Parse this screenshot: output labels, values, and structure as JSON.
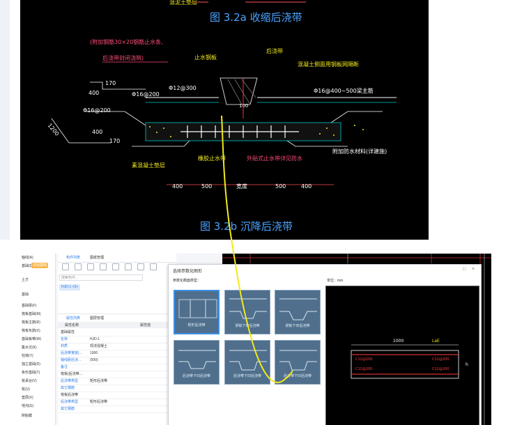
{
  "cad_drawing": {
    "top_caption": "图 3.2a 收缩后浇带",
    "top_fragment_left": "混泥土垫层",
    "bottom_caption": "图 3.2b 沉降后浇带",
    "labels": {
      "steel_bar_note_1": "(附加钢筋30×20钢筋止水条,",
      "steel_bar_note_2": "后浇带封闭浇筑)",
      "water_stop": "止水钢板",
      "post_pour_band": "后浇带",
      "formwork_note": "混凝土侧面用钢板网隔断",
      "dim_170_top": "170",
      "dim_400_top": "400",
      "bar_16_200_a": "Φ16@200",
      "bar_12_300": "Φ12@300",
      "bar_16_400_500": "Φ16@400~500梁主筋",
      "bar_16_200_b": "Φ16@200",
      "dim_1200": "1200",
      "dim_400_left": "400",
      "dim_170_left": "170",
      "dim_100": "100",
      "plain_concrete": "素混凝土垫层",
      "waterproof_layer": "橡胶止水带",
      "external_waterproof": "外贴式止水带详见防水",
      "additional_waterproof": "附加防水材料(详建施)",
      "dim_row": [
        "400",
        "500",
        "宽度",
        "500",
        "400"
      ]
    }
  },
  "app": {
    "left_nav": {
      "items": [
        "轴线(A)",
        "基础(D)",
        "土方",
        "基础",
        "基础梁(F)",
        "筏板基础(M)",
        "筏板主筋(R)",
        "筏板负筋(X)",
        "基础板带(W)",
        "集水坑(K)",
        "柱墩(Y)",
        "独立基础(D)",
        "条形基础(T)",
        "桩承台(V)",
        "桩(U)",
        "垫层(X)",
        "地沟(G)",
        "砖胎膜"
      ],
      "highlight_badge": "识别基础"
    },
    "mid_panel": {
      "tabs": [
        "构件列表",
        "图纸管理"
      ],
      "search_placeholder": "搜索构件...",
      "selected_chip": "HJD-1 <0>",
      "prop_tabs": [
        "属性列表",
        "图层管理"
      ],
      "prop_header": [
        "属性名称",
        "属性值"
      ],
      "rows": [
        {
          "k": "基础属性",
          "v": "",
          "group": true
        },
        {
          "k": "名称",
          "v": "HJD-1",
          "group": false
        },
        {
          "k": "材质",
          "v": "现浇混凝土",
          "group": false
        },
        {
          "k": "后浇带宽度(...",
          "v": "1000",
          "group": false
        },
        {
          "k": "轴线距后浇...",
          "v": "(500)",
          "group": false
        },
        {
          "k": "备注",
          "v": "",
          "group": false
        },
        {
          "k": "筏板(后浇带...",
          "v": "",
          "group": true
        },
        {
          "k": "后浇带类型",
          "v": "矩形后浇带",
          "group": false
        },
        {
          "k": "其它钢筋",
          "v": "",
          "group": false
        },
        {
          "k": "筏板后浇带",
          "v": "",
          "group": true
        },
        {
          "k": "后浇带类型",
          "v": "矩形后浇带",
          "group": false
        },
        {
          "k": "其它钢筋",
          "v": "",
          "group": false
        }
      ]
    },
    "dialog": {
      "title": "选择参数化图形",
      "subtitle": "参数化截面类型：",
      "unit": "单位：mm",
      "close": "×",
      "restore": "□",
      "options": [
        {
          "label": "矩形后浇带",
          "selected": true
        },
        {
          "label": "梁板下凹后浇带",
          "selected": false
        },
        {
          "label": "梁板下凹后浇带",
          "selected": false
        },
        {
          "label": "后浇带下凹后浇带",
          "selected": false
        },
        {
          "label": "后浇带下凹后浇带",
          "selected": false
        },
        {
          "label": "后浇带下凹后浇带",
          "selected": false
        }
      ],
      "preview": {
        "dim_top": "1000",
        "dim_lae": "LaE",
        "rebar_left_top": "C12@200",
        "rebar_left_bottom": "C12@200",
        "rebar_right_top": "C12@200",
        "rebar_right_bottom": "C12@200",
        "h_label": "h"
      }
    }
  },
  "annotation_color": "#f2ea1a"
}
